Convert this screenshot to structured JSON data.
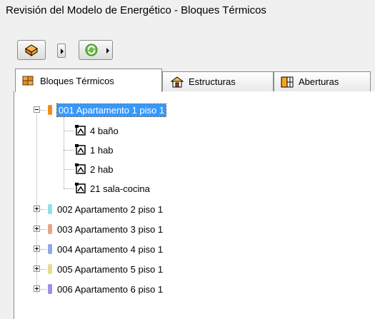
{
  "window": {
    "title": "Revisión del Modelo de Energético - Bloques Térmicos"
  },
  "toolbar": {
    "buttons": [
      {
        "icon": "orange-block-icon"
      },
      {
        "icon": "green-refresh-icon"
      }
    ]
  },
  "tabs": [
    {
      "label": "Bloques Térmicos",
      "icon": "blocks-icon",
      "active": true
    },
    {
      "label": "Estructuras",
      "icon": "house-icon",
      "active": false
    },
    {
      "label": "Aberturas",
      "icon": "window-icon",
      "active": false
    }
  ],
  "tree": {
    "blocks": [
      {
        "label": "001 Apartamento 1 piso 1",
        "color": "#f28c1e",
        "expanded": true,
        "selected": true,
        "children": [
          {
            "label": "4 baño"
          },
          {
            "label": "1 hab"
          },
          {
            "label": "2 hab"
          },
          {
            "label": "21 sala-cocina"
          }
        ]
      },
      {
        "label": "002 Apartamento 2 piso 1",
        "color": "#8fe1e8",
        "expanded": false
      },
      {
        "label": "003 Apartamento 3 piso 1",
        "color": "#e8a48c",
        "expanded": false
      },
      {
        "label": "004 Apartamento 4 piso 1",
        "color": "#8fa8e8",
        "expanded": false
      },
      {
        "label": "005 Apartamento 5 piso 1",
        "color": "#e8dc8f",
        "expanded": false
      },
      {
        "label": "006 Apartamento 6 piso 1",
        "color": "#9e8fe8",
        "expanded": false
      }
    ]
  }
}
